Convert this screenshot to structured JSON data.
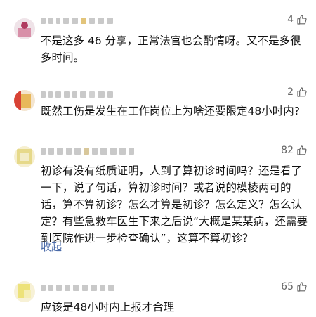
{
  "comments": [
    {
      "likes": "4",
      "text": "不是这多 46 分享，正常法官也会酌情呀。又不是多很多时间。"
    },
    {
      "likes": "2",
      "text": "既然工伤是发生在工作岗位上为啥还要限定48小时内?"
    },
    {
      "likes": "82",
      "text": "初诊有没有纸质证明，人到了算初诊时间吗？还是看了一下，说了句话，算初诊时间？或者说的模棱两可的话，算不算初诊？怎么才算是初诊？怎么定义？怎么认定？有些急救车医生下来之后说“大概是某某病，还需要到医院作进一步检查确认”，这算不算初诊？",
      "collapse_label": "收起"
    },
    {
      "likes": "65",
      "text": "应该是48小时内上报才合理"
    }
  ],
  "icons": {
    "like": "thumbs-up-icon"
  }
}
